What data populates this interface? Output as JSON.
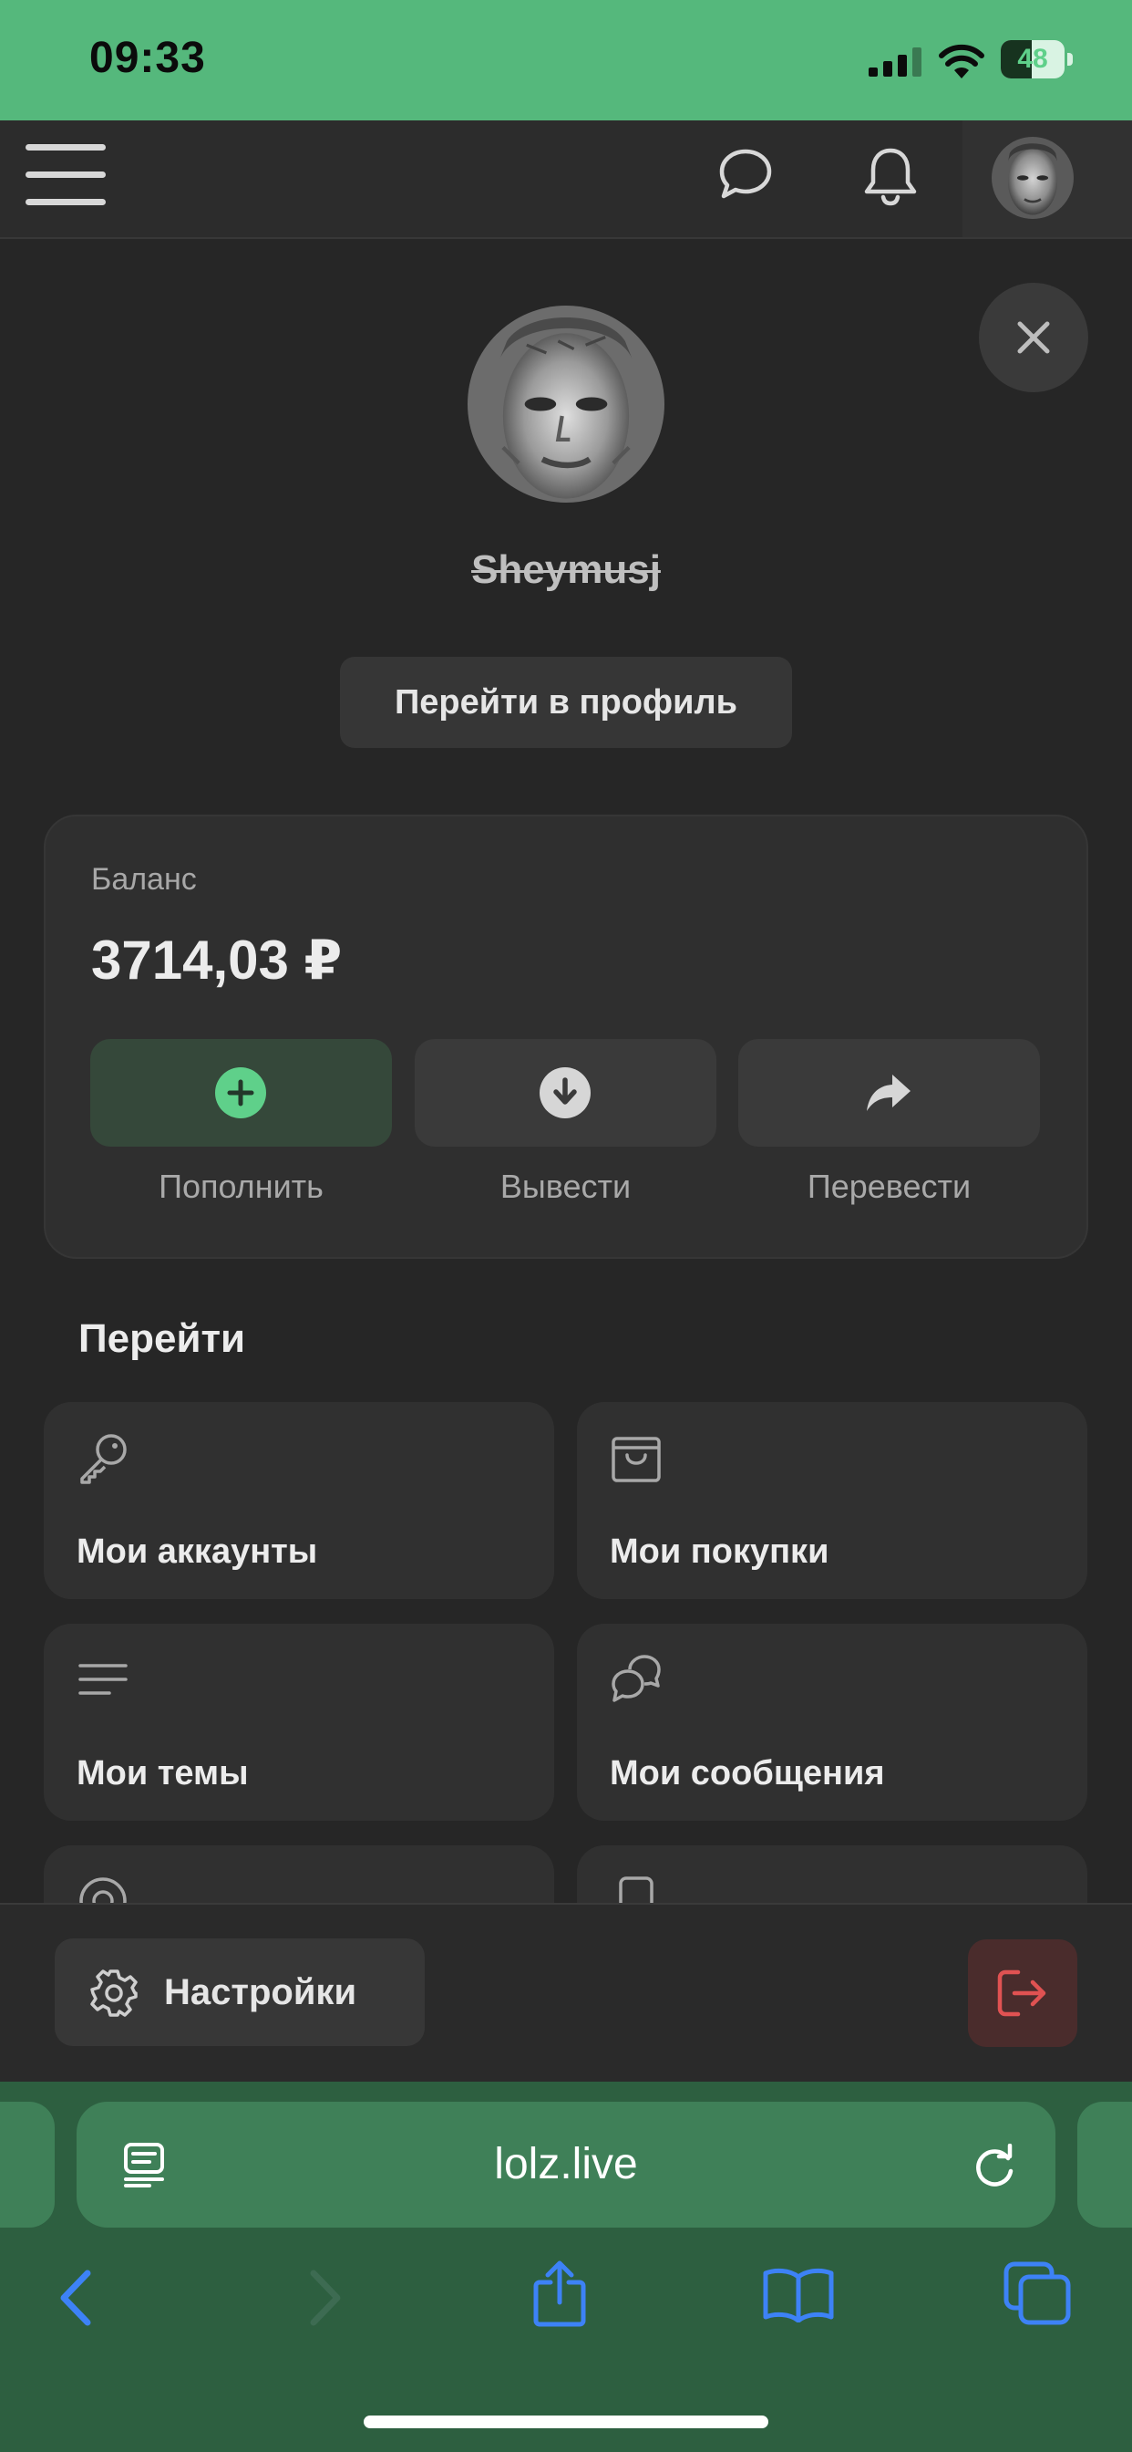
{
  "status_bar": {
    "time": "09:33",
    "battery": "48",
    "battery_level": 0.48
  },
  "profile": {
    "username": "Sheymusj",
    "profile_button": "Перейти в профиль"
  },
  "balance": {
    "label": "Баланс",
    "amount": "3714,03 ₽",
    "actions": [
      {
        "label": "Пополнить",
        "icon": "plus-circle-icon"
      },
      {
        "label": "Вывести",
        "icon": "arrow-down-circle-icon"
      },
      {
        "label": "Перевести",
        "icon": "share-arrow-icon"
      }
    ]
  },
  "navigate": {
    "title": "Перейти",
    "items": [
      {
        "label": "Мои аккаунты",
        "icon": "key-icon"
      },
      {
        "label": "Мои покупки",
        "icon": "shopping-bag-icon"
      },
      {
        "label": "Мои темы",
        "icon": "lines-icon"
      },
      {
        "label": "Мои сообщения",
        "icon": "chat-bubbles-icon"
      }
    ]
  },
  "bottom": {
    "settings_label": "Настройки"
  },
  "browser": {
    "url": "lolz.live"
  },
  "colors": {
    "status_bar": "#55b87c",
    "accent_green": "#5fd08a",
    "background": "#262626",
    "logout_red": "#e05252",
    "browser_bar": "#2d5f40",
    "browser_icon_blue": "#3d82f6"
  }
}
